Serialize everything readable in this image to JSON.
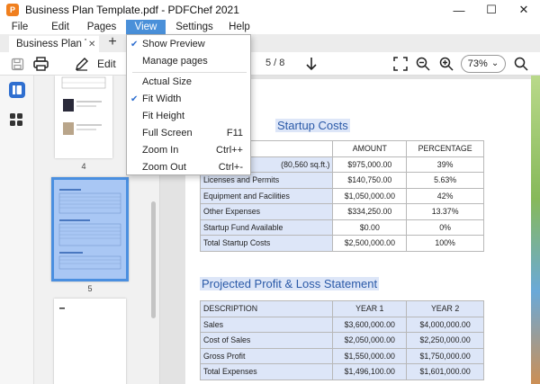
{
  "window": {
    "title": "Business Plan Template.pdf - PDFChef 2021",
    "logo_letter": "P",
    "minimize": "—",
    "maximize": "☐",
    "close": "✕"
  },
  "menubar": {
    "items": [
      "File",
      "Edit",
      "Pages",
      "View",
      "Settings",
      "Help"
    ]
  },
  "tabs": {
    "active_label": "Business Plan T...",
    "close_glyph": "✕",
    "add_glyph": "+"
  },
  "toolbar": {
    "edit_label": "Edit",
    "page_counter": "5 / 8",
    "zoom_value": "73%",
    "zoom_caret": "⌄"
  },
  "view_menu": {
    "items": [
      {
        "label": "Show Preview",
        "checked": true,
        "shortcut": ""
      },
      {
        "label": "Manage pages",
        "checked": false,
        "shortcut": ""
      },
      {
        "label": "Actual Size",
        "checked": false,
        "shortcut": ""
      },
      {
        "label": "Fit Width",
        "checked": true,
        "shortcut": ""
      },
      {
        "label": "Fit Height",
        "checked": false,
        "shortcut": ""
      },
      {
        "label": "Full Screen",
        "checked": false,
        "shortcut": "F11"
      },
      {
        "label": "Zoom In",
        "checked": false,
        "shortcut": "Ctrl++"
      },
      {
        "label": "Zoom Out",
        "checked": false,
        "shortcut": "Ctrl+-"
      }
    ]
  },
  "thumbnails": {
    "pages": [
      "4",
      "5"
    ]
  },
  "document": {
    "startup_heading": "Startup Costs",
    "startup_table": {
      "headers": [
        "",
        "AMOUNT",
        "PERCENTAGE"
      ],
      "rows": [
        [
          "(80,560 sq.ft.)",
          "$975,000.00",
          "39%"
        ],
        [
          "Licenses and Permits",
          "$140,750.00",
          "5.63%"
        ],
        [
          "Equipment and Facilities",
          "$1,050,000.00",
          "42%"
        ],
        [
          "Other Expenses",
          "$334,250.00",
          "13.37%"
        ],
        [
          "Startup Fund Available",
          "$0.00",
          "0%"
        ],
        [
          "Total Startup Costs",
          "$2,500,000.00",
          "100%"
        ]
      ]
    },
    "pl_heading": "Projected Profit & Loss Statement",
    "pl_table": {
      "headers": [
        "DESCRIPTION",
        "YEAR 1",
        "YEAR 2"
      ],
      "rows": [
        [
          "Sales",
          "$3,600,000.00",
          "$4,000,000.00"
        ],
        [
          "Cost of Sales",
          "$2,050,000.00",
          "$2,250,000.00"
        ],
        [
          "Gross Profit",
          "$1,550,000.00",
          "$1,750,000.00"
        ],
        [
          "Total Expenses",
          "$1,496,100.00",
          "$1,601,000.00"
        ]
      ]
    }
  },
  "colors": {
    "accent": "#4a90d9",
    "heading": "#2b5aa8",
    "highlight": "#dde6f8",
    "check": "#2f6fd0"
  }
}
